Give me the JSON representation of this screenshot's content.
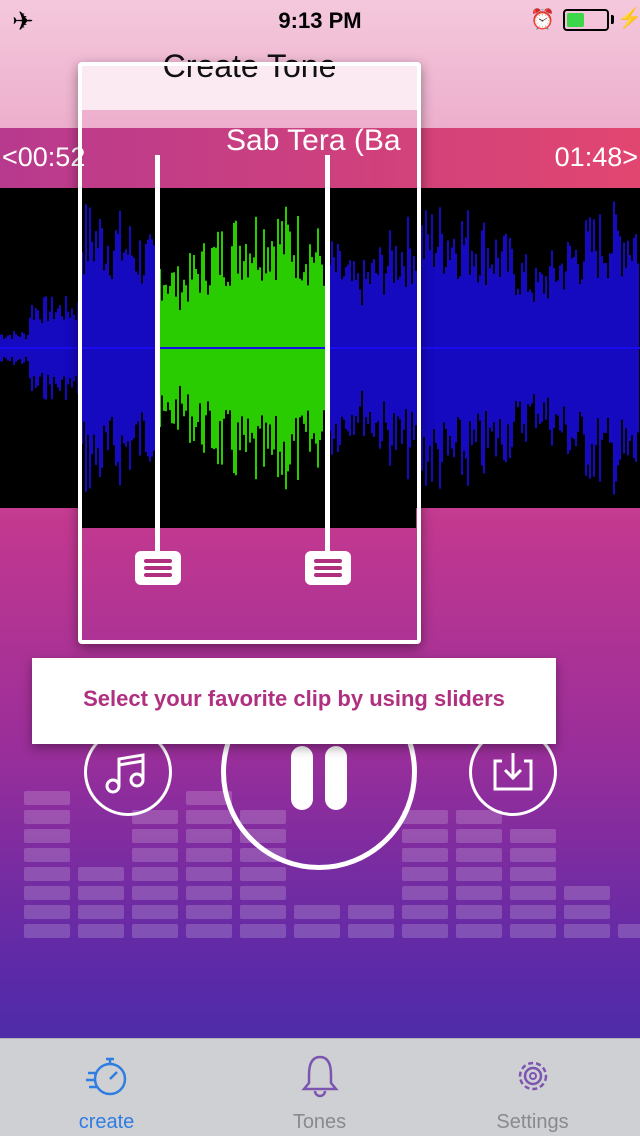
{
  "status_bar": {
    "time": "9:13 PM",
    "battery_level": 0.45,
    "icons": [
      "airplane-icon",
      "alarm-icon",
      "battery-icon",
      "charging-bolt-icon"
    ]
  },
  "screen": {
    "title": "Create Tone"
  },
  "track": {
    "start_time": "<00:52",
    "end_time": "01:48>",
    "title": "Sab Tera (Ba"
  },
  "waveform": {
    "selected_color": "#33ff00",
    "unselected_color": "#1b0cf0",
    "background_color": "#000000"
  },
  "tooltip": {
    "text": "Select your favorite clip by using sliders"
  },
  "controls": {
    "icons": [
      "music-note-icon",
      "pause-icon",
      "export-icon"
    ]
  },
  "tab_bar": {
    "tabs": [
      {
        "label": "create",
        "icon": "stopwatch-icon",
        "active": true
      },
      {
        "label": "Tones",
        "icon": "bell-icon",
        "active": false
      },
      {
        "label": "Settings",
        "icon": "gear-icon",
        "active": false
      }
    ],
    "active_color": "#2f7de0",
    "inactive_color": "#8a8a8e"
  }
}
